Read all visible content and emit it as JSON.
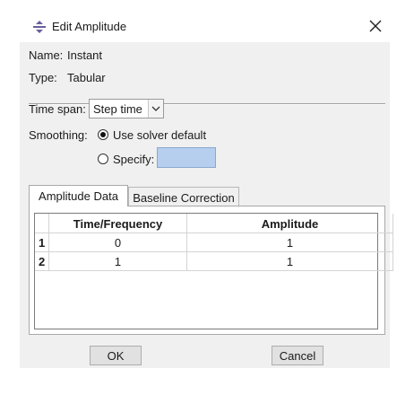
{
  "window": {
    "title": "Edit Amplitude",
    "title_icon": "amplitude-app-icon",
    "close_icon": "close-icon"
  },
  "info": {
    "name_label": "Name:",
    "name_value": "Instant",
    "type_label": "Type:",
    "type_value": "Tabular"
  },
  "time_span": {
    "label": "Time span:",
    "value": "Step time"
  },
  "smoothing": {
    "label": "Smoothing:",
    "option_default": "Use solver default",
    "option_specify": "Specify:",
    "selected": "Use solver default",
    "specify_value": ""
  },
  "tabs": [
    {
      "label": "Amplitude Data",
      "active": true
    },
    {
      "label": "Baseline Correction",
      "active": false
    }
  ],
  "table": {
    "columns": [
      "Time/Frequency",
      "Amplitude"
    ],
    "rows": [
      {
        "index": "1",
        "cells": [
          "0",
          "1"
        ]
      },
      {
        "index": "2",
        "cells": [
          "1",
          "1"
        ]
      }
    ]
  },
  "buttons": {
    "ok": "OK",
    "cancel": "Cancel"
  },
  "colors": {
    "dialog_bg": "#f0f0f0",
    "specify_field": "#b6cfee"
  }
}
